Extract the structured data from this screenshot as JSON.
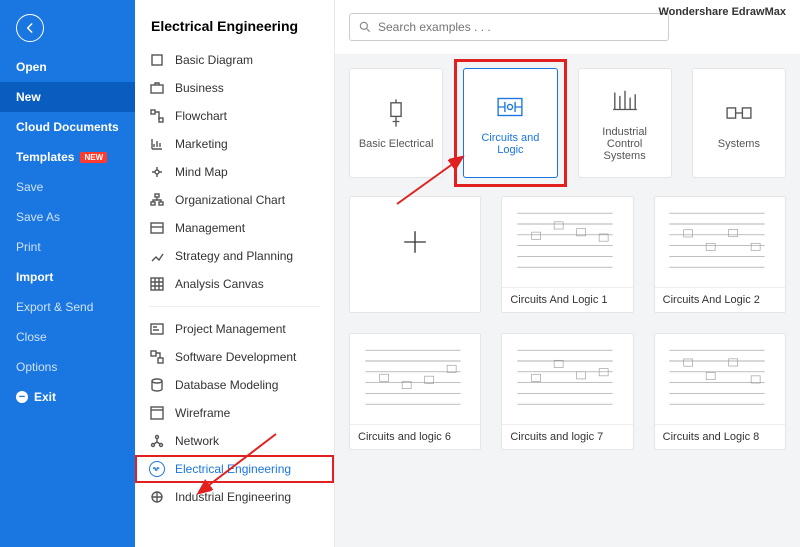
{
  "brand": "Wondershare EdrawMax",
  "sidebar": {
    "items": [
      {
        "label": "Open",
        "bold": true
      },
      {
        "label": "New",
        "bold": true,
        "active": true
      },
      {
        "label": "Cloud Documents",
        "bold": true
      },
      {
        "label": "Templates",
        "bold": true,
        "badge": "NEW"
      },
      {
        "label": "Save"
      },
      {
        "label": "Save As"
      },
      {
        "label": "Print"
      },
      {
        "label": "Import",
        "bold": true
      },
      {
        "label": "Export & Send"
      },
      {
        "label": "Close"
      },
      {
        "label": "Options"
      },
      {
        "label": "Exit",
        "bold": true,
        "icon": "minus"
      }
    ]
  },
  "categories": {
    "header": "Electrical Engineering",
    "top": [
      {
        "label": "Basic Diagram",
        "icon": "square"
      },
      {
        "label": "Business",
        "icon": "briefcase"
      },
      {
        "label": "Flowchart",
        "icon": "flow"
      },
      {
        "label": "Marketing",
        "icon": "chart"
      },
      {
        "label": "Mind Map",
        "icon": "mind"
      },
      {
        "label": "Organizational Chart",
        "icon": "org"
      },
      {
        "label": "Management",
        "icon": "manage"
      },
      {
        "label": "Strategy and Planning",
        "icon": "strategy"
      },
      {
        "label": "Analysis Canvas",
        "icon": "canvas"
      }
    ],
    "bottom": [
      {
        "label": "Project Management",
        "icon": "project"
      },
      {
        "label": "Software Development",
        "icon": "software"
      },
      {
        "label": "Database Modeling",
        "icon": "database"
      },
      {
        "label": "Wireframe",
        "icon": "wireframe"
      },
      {
        "label": "Network",
        "icon": "network"
      },
      {
        "label": "Electrical Engineering",
        "icon": "ee",
        "selected": true
      },
      {
        "label": "Industrial Engineering",
        "icon": "ie"
      }
    ]
  },
  "search": {
    "placeholder": "Search examples . . ."
  },
  "tiles": [
    {
      "label": "Basic Electrical"
    },
    {
      "label": "Circuits and Logic",
      "selected": true
    },
    {
      "label": "Industrial Control Systems"
    },
    {
      "label": "Systems"
    }
  ],
  "templates": [
    {
      "label": "",
      "blank": true
    },
    {
      "label": "Circuits And Logic 1"
    },
    {
      "label": "Circuits And Logic 2"
    },
    {
      "label": "Circuits and logic 6"
    },
    {
      "label": "Circuits and logic 7"
    },
    {
      "label": "Circuits and Logic 8"
    }
  ]
}
